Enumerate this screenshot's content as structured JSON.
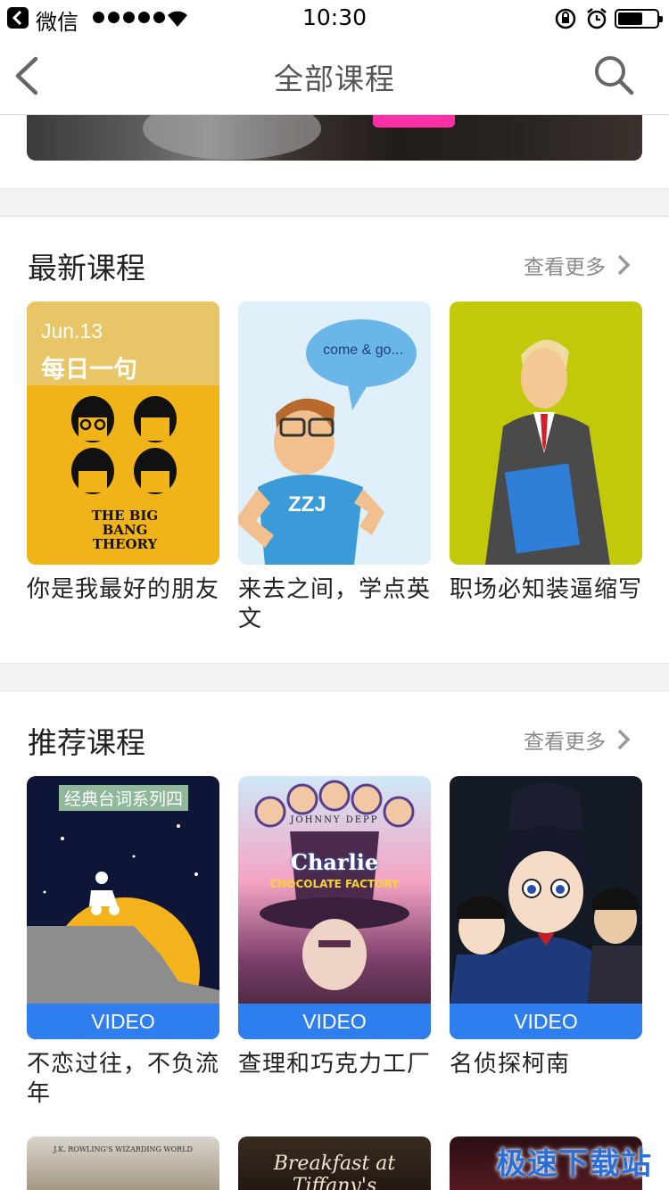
{
  "status_bar": {
    "app_name": "微信",
    "time": "10:30"
  },
  "nav": {
    "title": "全部课程"
  },
  "sections": [
    {
      "title": "最新课程",
      "more_label": "查看更多",
      "cards": [
        {
          "caption": "你是我最好的朋友",
          "thumb_text_date": "Jun.13",
          "thumb_text_title": "每日一句",
          "thumb_text_logo": "THE BIG BANG THEORY"
        },
        {
          "caption": "来去之间，学点英文",
          "bubble_text": "come & go...",
          "shirt_text": "ZZJ"
        },
        {
          "caption": "职场必知装逼缩写"
        }
      ]
    },
    {
      "title": "推荐课程",
      "more_label": "查看更多",
      "cards": [
        {
          "caption": "不恋过往，不负流年",
          "badge": "VIDEO",
          "thumb_text_title": "经典台词系列四"
        },
        {
          "caption": "查理和巧克力工厂",
          "badge": "VIDEO",
          "thumb_text_title": "Charlie",
          "thumb_text_sub": "CHOCOLATE FACTORY",
          "thumb_text_top": "JOHNNY DEPP"
        },
        {
          "caption": "名侦探柯南",
          "badge": "VIDEO"
        }
      ]
    }
  ],
  "bottom_row": {
    "thumb_texts": [
      "J.K. ROWLING'S WIZARDING WORLD",
      "Breakfast at Tiffany's",
      ""
    ]
  },
  "watermark": "极速下载站",
  "colors": {
    "video_badge": "#2f7ef0",
    "more_text": "#8a8a8a",
    "divider": "#f2f2f2"
  }
}
